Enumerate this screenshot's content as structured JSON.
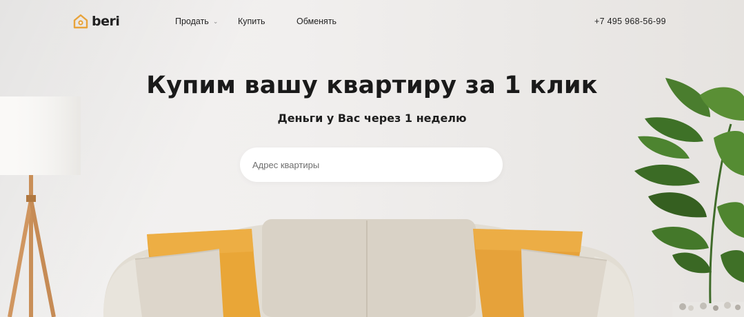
{
  "header": {
    "logo_text": "beri",
    "nav": {
      "sell": "Продать",
      "buy": "Купить",
      "exchange": "Обменять"
    },
    "phone": "+7 495 968-56-99"
  },
  "hero": {
    "title": "Купим вашу квартиру за 1 клик",
    "subtitle": "Деньги у Вас через 1 неделю",
    "address_placeholder": "Адрес квартиры"
  },
  "colors": {
    "accent": "#e8a33a",
    "text": "#1a1a1a",
    "background": "#efedeb"
  },
  "icons": [
    "house-logo-icon",
    "chevron-down-icon"
  ]
}
